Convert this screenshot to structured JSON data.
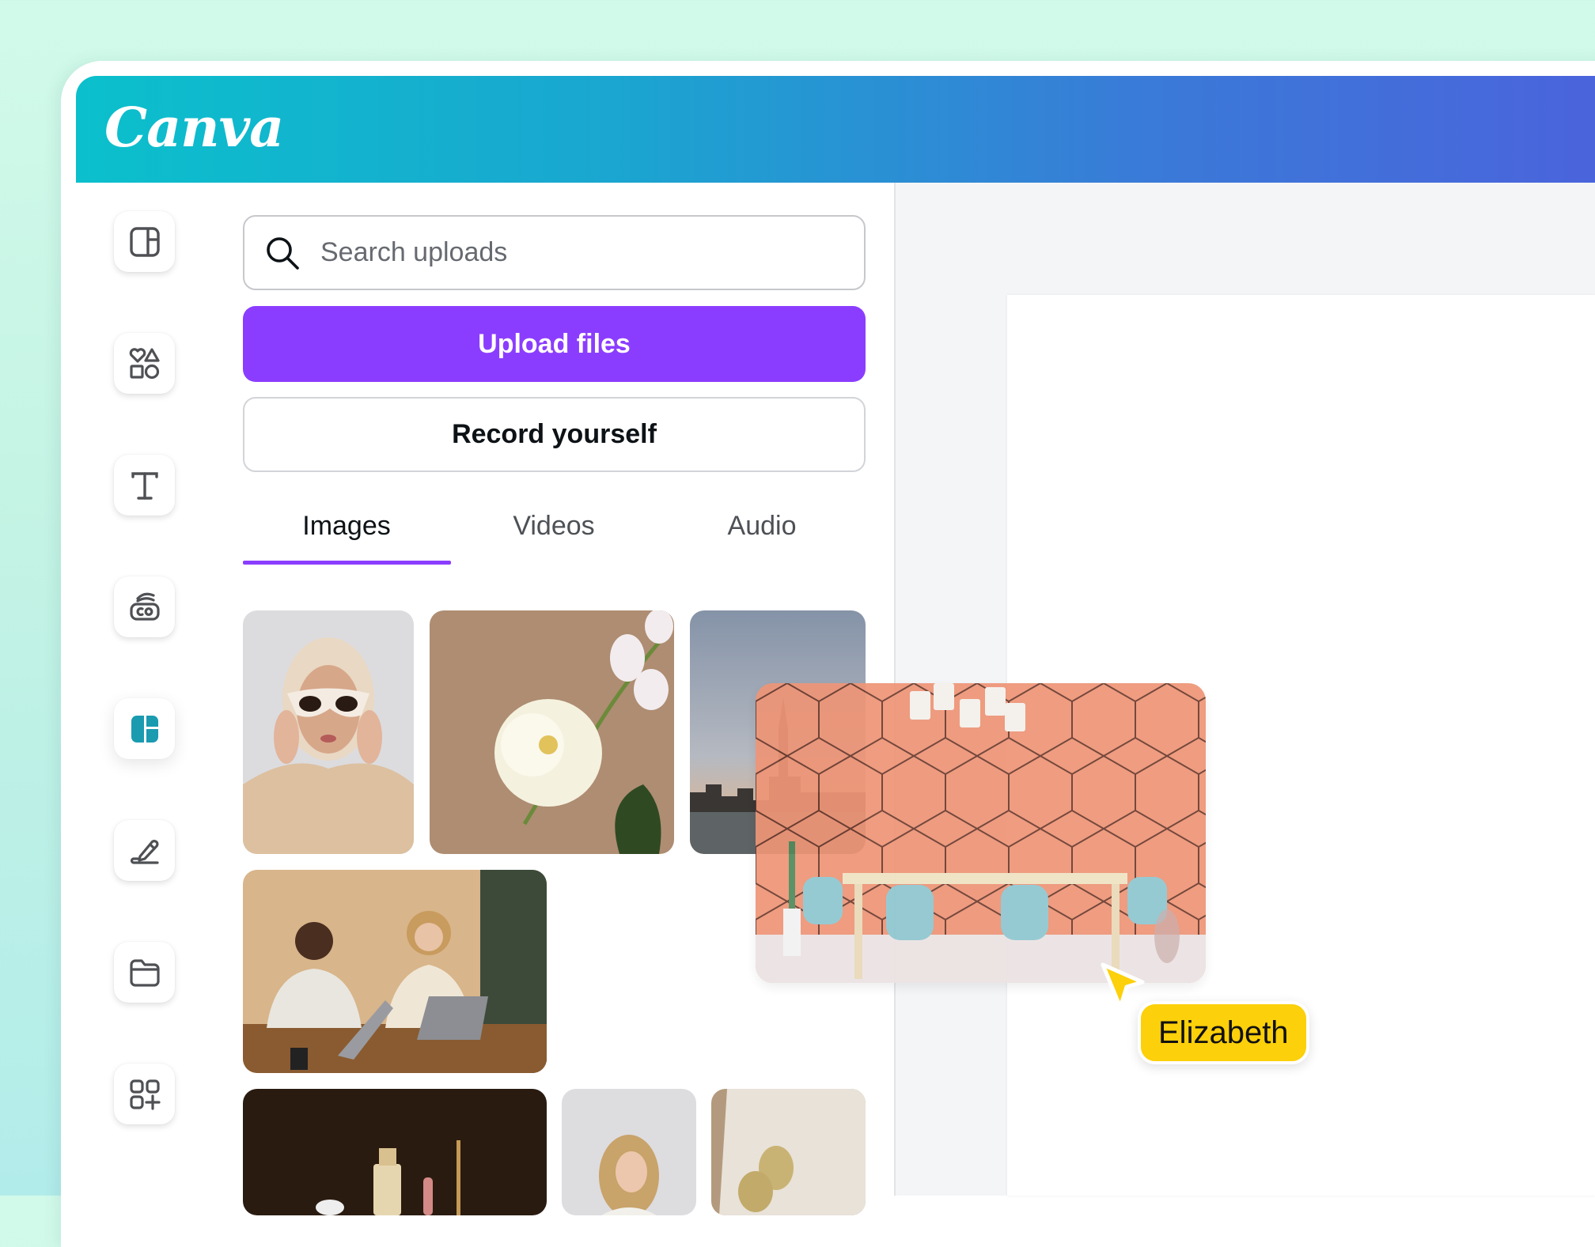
{
  "app": {
    "logo_text": "Canva"
  },
  "colors": {
    "accent": "#8b3dff",
    "active_icon": "#1a9bb0",
    "icon": "#4e5054",
    "header_start": "#0bc0cc",
    "header_end": "#4b63dc",
    "collaborator_badge": "#fcd00a"
  },
  "sidebar": {
    "items": [
      {
        "icon": "design-layout-icon",
        "active": false
      },
      {
        "icon": "elements-shapes-icon",
        "active": false
      },
      {
        "icon": "text-icon",
        "active": false
      },
      {
        "icon": "brand-hub-icon",
        "active": false
      },
      {
        "icon": "uploads-icon",
        "active": true
      },
      {
        "icon": "draw-icon",
        "active": false
      },
      {
        "icon": "projects-folder-icon",
        "active": false
      },
      {
        "icon": "apps-icon",
        "active": false
      }
    ]
  },
  "uploads_panel": {
    "search": {
      "placeholder": "Search uploads",
      "value": ""
    },
    "upload_button": "Upload files",
    "record_button": "Record yourself",
    "tabs": [
      {
        "label": "Images",
        "active": true
      },
      {
        "label": "Videos",
        "active": false
      },
      {
        "label": "Audio",
        "active": false
      }
    ],
    "images": [
      {
        "subject": "woman in sunglasses and headscarf"
      },
      {
        "subject": "white peony and orchid"
      },
      {
        "subject": "city skyline at dusk"
      },
      {
        "subject": "two people with laptops"
      },
      {
        "subject": "cosmetics on dark background"
      },
      {
        "subject": "smiling woman with curly hair"
      },
      {
        "subject": "pears on linen"
      }
    ]
  },
  "canvas": {
    "dragged_image": {
      "subject": "dining room with coral hexagon wall"
    },
    "collaborator_cursor": {
      "name": "Elizabeth"
    }
  }
}
